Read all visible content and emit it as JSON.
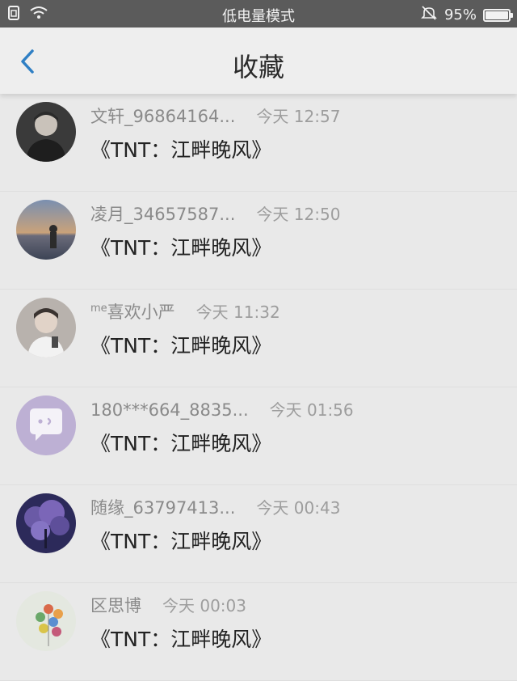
{
  "status_bar": {
    "center_text": "低电量模式",
    "battery_text": "95%"
  },
  "header": {
    "title": "收藏"
  },
  "items": [
    {
      "name": "文轩_96864164...",
      "time": "今天 12:57",
      "content": "《TNT：江畔晚风》",
      "avatar": "avatar-photo-dark"
    },
    {
      "name": "凌月_34657587...",
      "time": "今天 12:50",
      "content": "《TNT：江畔晚风》",
      "avatar": "avatar-sunset"
    },
    {
      "name_prefix": "me",
      "name": "喜欢小严",
      "time": "今天 11:32",
      "content": "《TNT：江畔晚风》",
      "avatar": "avatar-photo-boy"
    },
    {
      "name": "180***664_8835...",
      "time": "今天 01:56",
      "content": "《TNT：江畔晚风》",
      "avatar": "avatar-chat-default"
    },
    {
      "name": "随缘_63797413...",
      "time": "今天 00:43",
      "content": "《TNT：江畔晚风》",
      "avatar": "avatar-purple-tree"
    },
    {
      "name": "区思博",
      "time": "今天 00:03",
      "content": "《TNT：江畔晚风》",
      "avatar": "avatar-balloons"
    }
  ],
  "colors": {
    "accent": "#2f7fc4",
    "status_bar_bg": "#5b5b5b",
    "page_bg": "#e9e9e9"
  }
}
